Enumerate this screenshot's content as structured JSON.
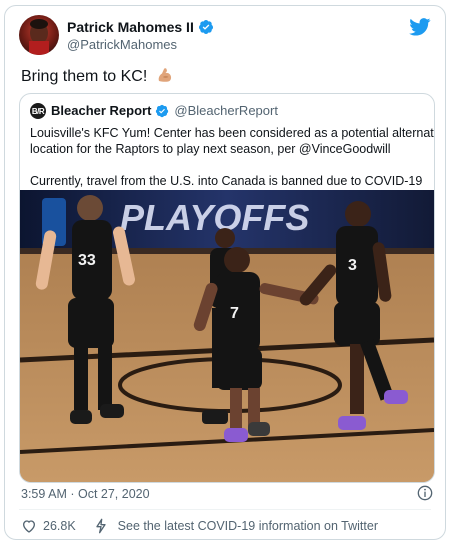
{
  "tweet": {
    "author_name": "Patrick Mahomes II",
    "author_handle": "@PatrickMahomes",
    "text": "Bring them to KC!",
    "emoji_name": "flexed-biceps-emoji",
    "timestamp": "3:59 AM · Oct 27, 2020",
    "like_count": "26.8K",
    "covid_link_text": "See the latest COVID-19 information on Twitter"
  },
  "quoted": {
    "avatar_text": "B/R",
    "author_name": "Bleacher Report",
    "author_handle": "@BleacherReport",
    "text_line1": "Louisville's KFC Yum! Center has been considered as a potential alternative",
    "text_line2": "location for the Raptors to play next season, per @VinceGoodwill",
    "text_line3": "Currently, travel from the U.S. into Canada is banned due to COVID-19",
    "image_banner_text": "PLAYOFFS",
    "jersey_numbers": [
      "33",
      "7",
      "3"
    ]
  },
  "colors": {
    "verified_blue": "#1d9bf0",
    "twitter_blue": "#1d9bf0",
    "jersey_black": "#141414",
    "jersey_red": "#c8102e",
    "court_wood": "#b88c5c"
  },
  "icons": [
    "verified-icon",
    "twitter-bird-icon",
    "info-icon",
    "heart-icon",
    "bolt-icon"
  ]
}
